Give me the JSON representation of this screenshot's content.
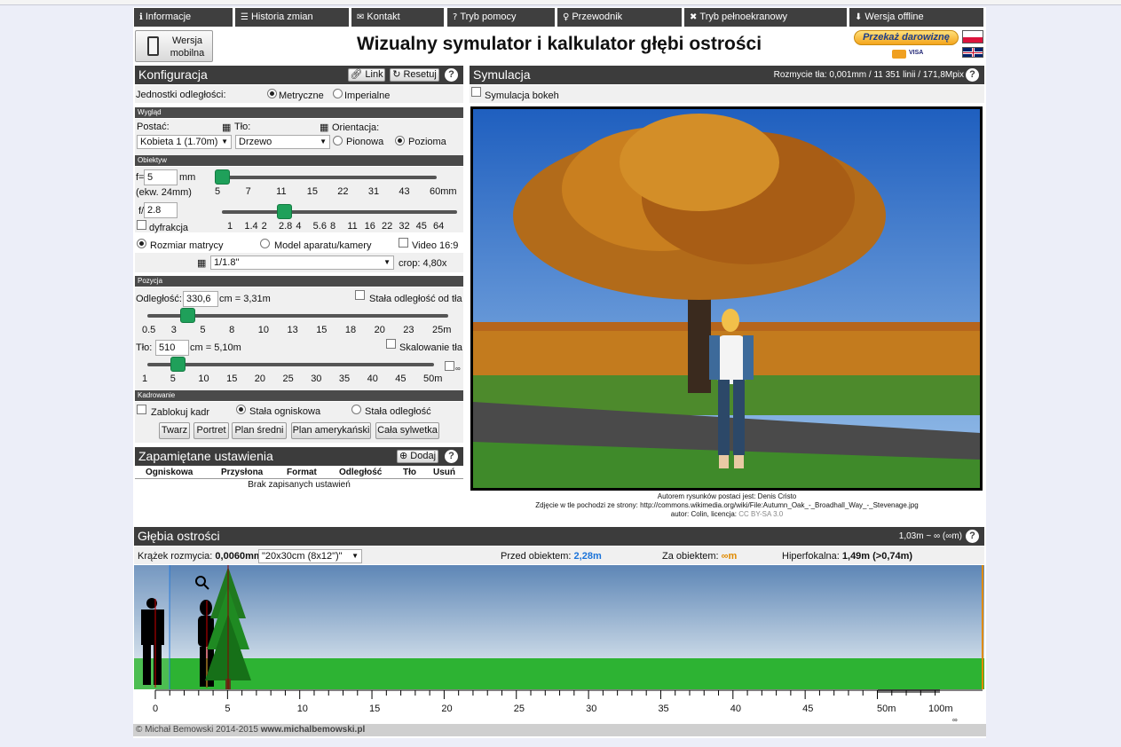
{
  "nav": [
    {
      "icon": "info-icon",
      "glyph": "ℹ",
      "label": "Informacje"
    },
    {
      "icon": "list-icon",
      "glyph": "☰",
      "label": "Historia zmian"
    },
    {
      "icon": "envelope-icon",
      "glyph": "✉",
      "label": "Kontakt"
    },
    {
      "icon": "question-icon",
      "glyph": "?",
      "label": "Tryb pomocy"
    },
    {
      "icon": "lightbulb-icon",
      "glyph": "♀",
      "label": "Przewodnik"
    },
    {
      "icon": "fullscreen-icon",
      "glyph": "✖",
      "label": "Tryb pełnoekranowy"
    },
    {
      "icon": "download-icon",
      "glyph": "⬇",
      "label": "Wersja offline"
    }
  ],
  "header": {
    "mobile_label_1": "Wersja",
    "mobile_label_2": "mobilna",
    "title": "Wizualny symulator i kalkulator głębi ostrości",
    "donate_label": "Przekaż darowiznę",
    "card_labels": "VISA"
  },
  "config": {
    "title": "Konfiguracja",
    "link_label": "Link",
    "reset_label": "Resetuj",
    "units_label": "Jednostki odległości:",
    "units_metric": "Metryczne",
    "units_imperial": "Imperialne",
    "look_header": "Wygląd",
    "figure_label": "Postać:",
    "figure_value": "Kobieta 1 (1.70m)",
    "background_label": "Tło:",
    "background_value": "Drzewo",
    "orientation_label": "Orientacja:",
    "orientation_portrait": "Pionowa",
    "orientation_landscape": "Pozioma",
    "lens_header": "Obiektyw",
    "focal_prefix": "f=",
    "focal_value": "5",
    "focal_unit": "mm",
    "focal_equiv": "(ekw. 24mm)",
    "focal_ticks": [
      "5",
      "7",
      "11",
      "15",
      "22",
      "31",
      "43",
      "60mm"
    ],
    "focal_position": 0.0,
    "aperture_prefix": "f/",
    "aperture_value": "2.8",
    "diffraction_label": "dyfrakcja",
    "aperture_ticks": [
      "1",
      "1.4",
      "2",
      "2.8",
      "4",
      "5.6",
      "8",
      "11",
      "16",
      "22",
      "32",
      "45",
      "64"
    ],
    "aperture_position": 0.25,
    "sensor_size_label": "Rozmiar matrycy",
    "camera_model_label": "Model aparatu/kamery",
    "video_label": "Video 16:9",
    "sensor_value": "1/1.8\"",
    "crop_label": "crop: 4,80x",
    "position_header": "Pozycja",
    "distance_label": "Odległość:",
    "distance_value": "330,6",
    "distance_suffix": "cm = 3,31m",
    "fixed_distance_label": "Stała odległość od tła",
    "distance_ticks": [
      "0.5",
      "3",
      "5",
      "8",
      "10",
      "13",
      "15",
      "18",
      "20",
      "23",
      "25m"
    ],
    "distance_position": 0.115,
    "bg_label": "Tło:",
    "bg_value": "510",
    "bg_suffix": "cm = 5,10m",
    "bg_scale_label": "Skalowanie tła",
    "bg_ticks": [
      "1",
      "5",
      "10",
      "15",
      "20",
      "25",
      "30",
      "35",
      "40",
      "45",
      "50m"
    ],
    "bg_position": 0.085,
    "infinity_label": "∞",
    "framing_header": "Kadrowanie",
    "lock_frame_label": "Zablokuj kadr",
    "fixed_focal_label": "Stała ogniskowa",
    "fixed_dist_label": "Stała odległość",
    "framing_buttons": [
      "Twarz",
      "Portret",
      "Plan średni",
      "Plan amerykański",
      "Cała sylwetka"
    ]
  },
  "saved": {
    "title": "Zapamiętane ustawienia",
    "add_label": "Dodaj",
    "columns": [
      "Ogniskowa",
      "Przysłona",
      "Format",
      "Odległość",
      "Tło",
      "Usuń"
    ],
    "empty": "Brak zapisanych ustawień"
  },
  "simulation": {
    "title": "Symulacja",
    "blur_info": "Rozmycie tła: 0,001mm / 11 351 linii / 171,8Mpix",
    "bokeh_label": "Symulacja bokeh",
    "credit_1": "Autorem rysunków postaci jest: Denis Cristo",
    "credit_2": "Zdjęcie w tle pochodzi ze strony: http://commons.wikimedia.org/wiki/File:Autumn_Oak_-_Broadhall_Way_-_Stevenage.jpg",
    "credit_3_prefix": "autor: Colin, licencja:",
    "credit_3_license": "CC BY-SA 3.0"
  },
  "dof": {
    "title": "Głębia ostrości",
    "range_info": "1,03m ~ ∞ (∞m)",
    "coc_label": "Krążek rozmycia:",
    "coc_value": "0,0060mm",
    "print_value": "\"20x30cm (8x12\")\"",
    "front_label": "Przed obiektem:",
    "front_value": "2,28m",
    "back_label": "Za obiektem:",
    "back_value": "∞m",
    "hyper_label": "Hiperfokalna:",
    "hyper_value": "1,49m (>0,74m)",
    "scale_labels": [
      "0",
      "5",
      "10",
      "15",
      "20",
      "25",
      "30",
      "35",
      "40",
      "45",
      "50m",
      "100m"
    ],
    "scale_infinity": "∞"
  },
  "footer": {
    "text_1": "© Michał Bemowski 2014-2015",
    "text_2": "www.michalbemowski.pl"
  },
  "colors": {
    "dark": "#3c3c3c",
    "slider": "#1fa05a",
    "front_value": "#1a73d9",
    "back_value": "#e08a00"
  }
}
